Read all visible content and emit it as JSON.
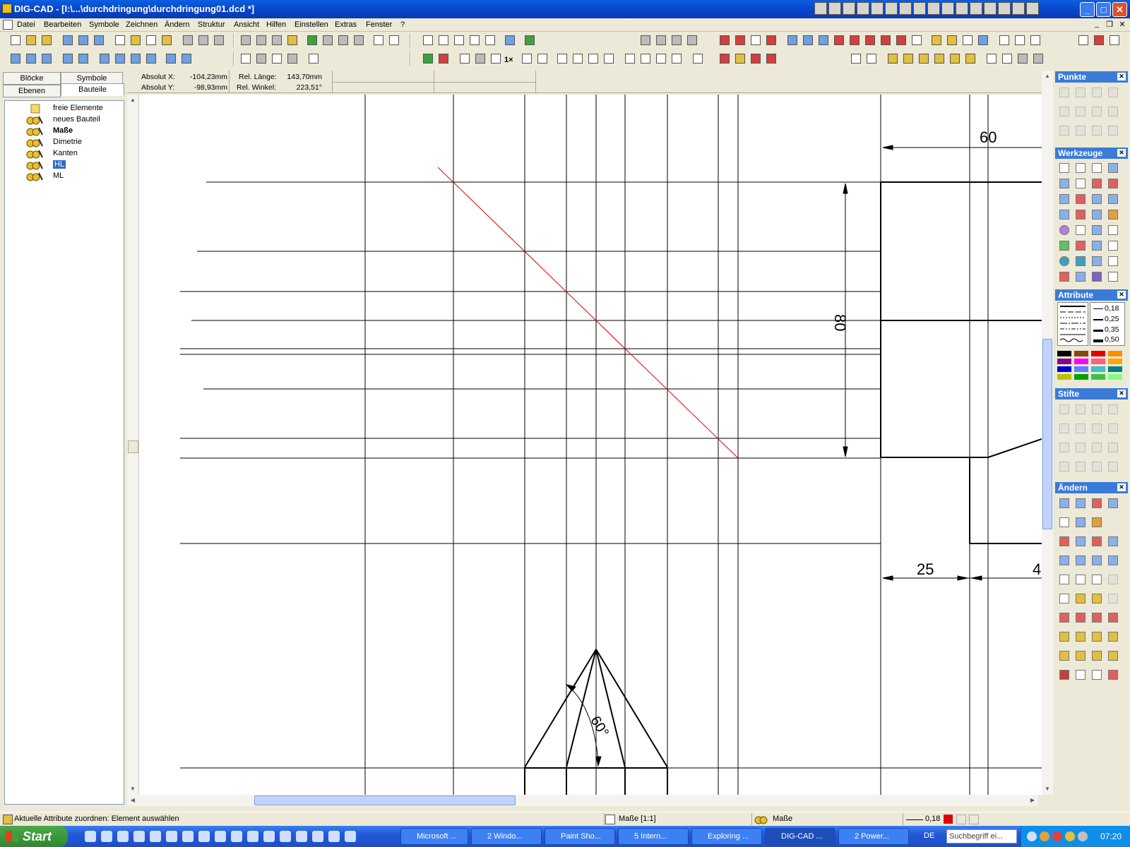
{
  "window": {
    "title": "DIG-CAD - [I:\\...\\durchdringung\\durchdringung01.dcd *]",
    "min": "_",
    "max": "□",
    "close": "✕"
  },
  "menu": [
    "Datei",
    "Bearbeiten",
    "Symbole",
    "Zeichnen",
    "Ändern",
    "Struktur",
    "Ansicht",
    "Hilfen",
    "Einstellen",
    "Extras",
    "Fenster",
    "?"
  ],
  "mdi": {
    "min": "_",
    "restore": "❐",
    "close": "✕"
  },
  "left_tabs": [
    "Blöcke",
    "Symbole",
    "Ebenen",
    "Bauteile"
  ],
  "tree": [
    {
      "label": "freie Elemente",
      "bold": false,
      "selected": false,
      "icon": "folder-icon"
    },
    {
      "label": "neues Bauteil",
      "bold": false,
      "selected": false,
      "icon": "component-icon"
    },
    {
      "label": "Maße",
      "bold": true,
      "selected": false,
      "icon": "component-icon"
    },
    {
      "label": "Dimetrie",
      "bold": false,
      "selected": false,
      "icon": "component-icon"
    },
    {
      "label": "Kanten",
      "bold": false,
      "selected": false,
      "icon": "component-icon"
    },
    {
      "label": "HL",
      "bold": false,
      "selected": true,
      "icon": "component-icon"
    },
    {
      "label": "ML",
      "bold": false,
      "selected": false,
      "icon": "component-icon"
    }
  ],
  "coords": {
    "abs_x_label": "Absolut X:",
    "abs_x": "-104,23mm",
    "abs_y_label": "Absolut Y:",
    "abs_y": "-98,93mm",
    "rel_len_label": "Rel. Länge:",
    "rel_len": "143,70mm",
    "rel_ang_label": "Rel. Winkel:",
    "rel_ang": "223,51°"
  },
  "drawing": {
    "dim_60": "60",
    "dim_80": "80",
    "dim_25": "25",
    "dim_4": "4",
    "angle": "60°"
  },
  "panels": {
    "punkte": "Punkte",
    "werkzeuge": "Werkzeuge",
    "attribute": "Attribute",
    "stifte": "Stifte",
    "aendern": "Ändern"
  },
  "line_widths": [
    "0,18",
    "0,25",
    "0,35",
    "0,50"
  ],
  "colors": [
    "#000000",
    "#8b4513",
    "#e00000",
    "#ff8c00",
    "#8b008b",
    "#ff00ff",
    "#ff6080",
    "#ffa500",
    "#0000cc",
    "#6080ff",
    "#40c0c0",
    "#008080",
    "#c0c000",
    "#00a000",
    "#40c040",
    "#80ff80"
  ],
  "tool_label_1x": "1×",
  "status": {
    "message": "Aktuelle Attribute zuordnen: Element auswählen",
    "layer": "Maße [1:1]",
    "part": "Maße",
    "width": "0,18"
  },
  "taskbar": {
    "start": "Start",
    "tasks": [
      "Microsoft ...",
      "2 Windo...",
      "Paint Sho...",
      "5 Intern...",
      "Exploring ...",
      "DIG-CAD ...",
      "2 Power..."
    ],
    "lang": "DE",
    "search_placeholder": "Suchbegriff ei...",
    "clock": "07:20"
  }
}
